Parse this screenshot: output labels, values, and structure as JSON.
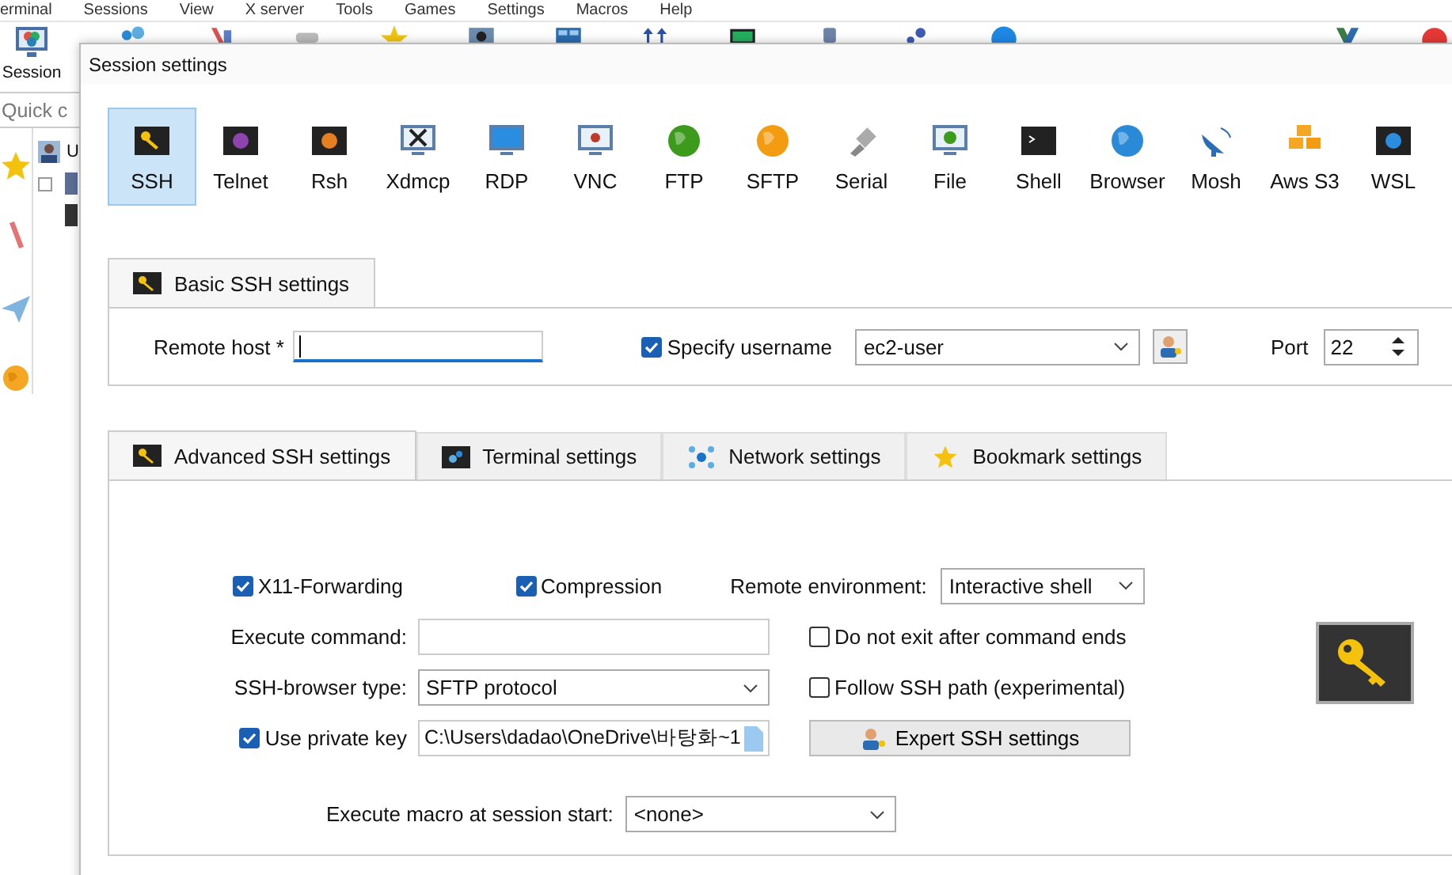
{
  "app": {
    "menu": [
      "erminal",
      "Sessions",
      "View",
      "X server",
      "Tools",
      "Games",
      "Settings",
      "Macros",
      "Help"
    ],
    "session_button": "Session",
    "quick_connect": {
      "placeholder": "Quick c"
    },
    "tree_item": "U"
  },
  "dialog": {
    "title": "Session settings",
    "session_types": [
      {
        "label": "SSH",
        "selected": true
      },
      {
        "label": "Telnet",
        "selected": false
      },
      {
        "label": "Rsh",
        "selected": false
      },
      {
        "label": "Xdmcp",
        "selected": false
      },
      {
        "label": "RDP",
        "selected": false
      },
      {
        "label": "VNC",
        "selected": false
      },
      {
        "label": "FTP",
        "selected": false
      },
      {
        "label": "SFTP",
        "selected": false
      },
      {
        "label": "Serial",
        "selected": false
      },
      {
        "label": "File",
        "selected": false
      },
      {
        "label": "Shell",
        "selected": false
      },
      {
        "label": "Browser",
        "selected": false
      },
      {
        "label": "Mosh",
        "selected": false
      },
      {
        "label": "Aws S3",
        "selected": false
      },
      {
        "label": "WSL",
        "selected": false
      }
    ],
    "basic_tab": "Basic SSH settings",
    "remote_host": {
      "label": "Remote host *"
    },
    "specify_username": {
      "label": "Specify username",
      "checked": true
    },
    "username": {
      "value": "ec2-user"
    },
    "port": {
      "label": "Port",
      "value": "22"
    },
    "advanced_tabs": [
      {
        "label": "Advanced SSH settings",
        "selected": true
      },
      {
        "label": "Terminal settings",
        "selected": false
      },
      {
        "label": "Network settings",
        "selected": false
      },
      {
        "label": "Bookmark settings",
        "selected": false
      }
    ],
    "x11_forwarding": {
      "label": "X11-Forwarding",
      "checked": true
    },
    "compression": {
      "label": "Compression",
      "checked": true
    },
    "remote_environment": {
      "label": "Remote environment:",
      "value": "Interactive shell"
    },
    "execute_command": {
      "label": "Execute command:"
    },
    "do_not_exit": {
      "label": "Do not exit after command ends",
      "checked": false
    },
    "ssh_browser_type": {
      "label": "SSH-browser type:",
      "value": "SFTP protocol"
    },
    "follow_ssh_path": {
      "label": "Follow SSH path (experimental)",
      "checked": false
    },
    "use_private_key": {
      "label": "Use private key",
      "checked": true,
      "value": "C:\\Users\\dadao\\OneDrive\\바탕화~1"
    },
    "expert_button": "Expert SSH settings",
    "macro": {
      "label": "Execute macro at session start:",
      "value": "<none>"
    }
  }
}
